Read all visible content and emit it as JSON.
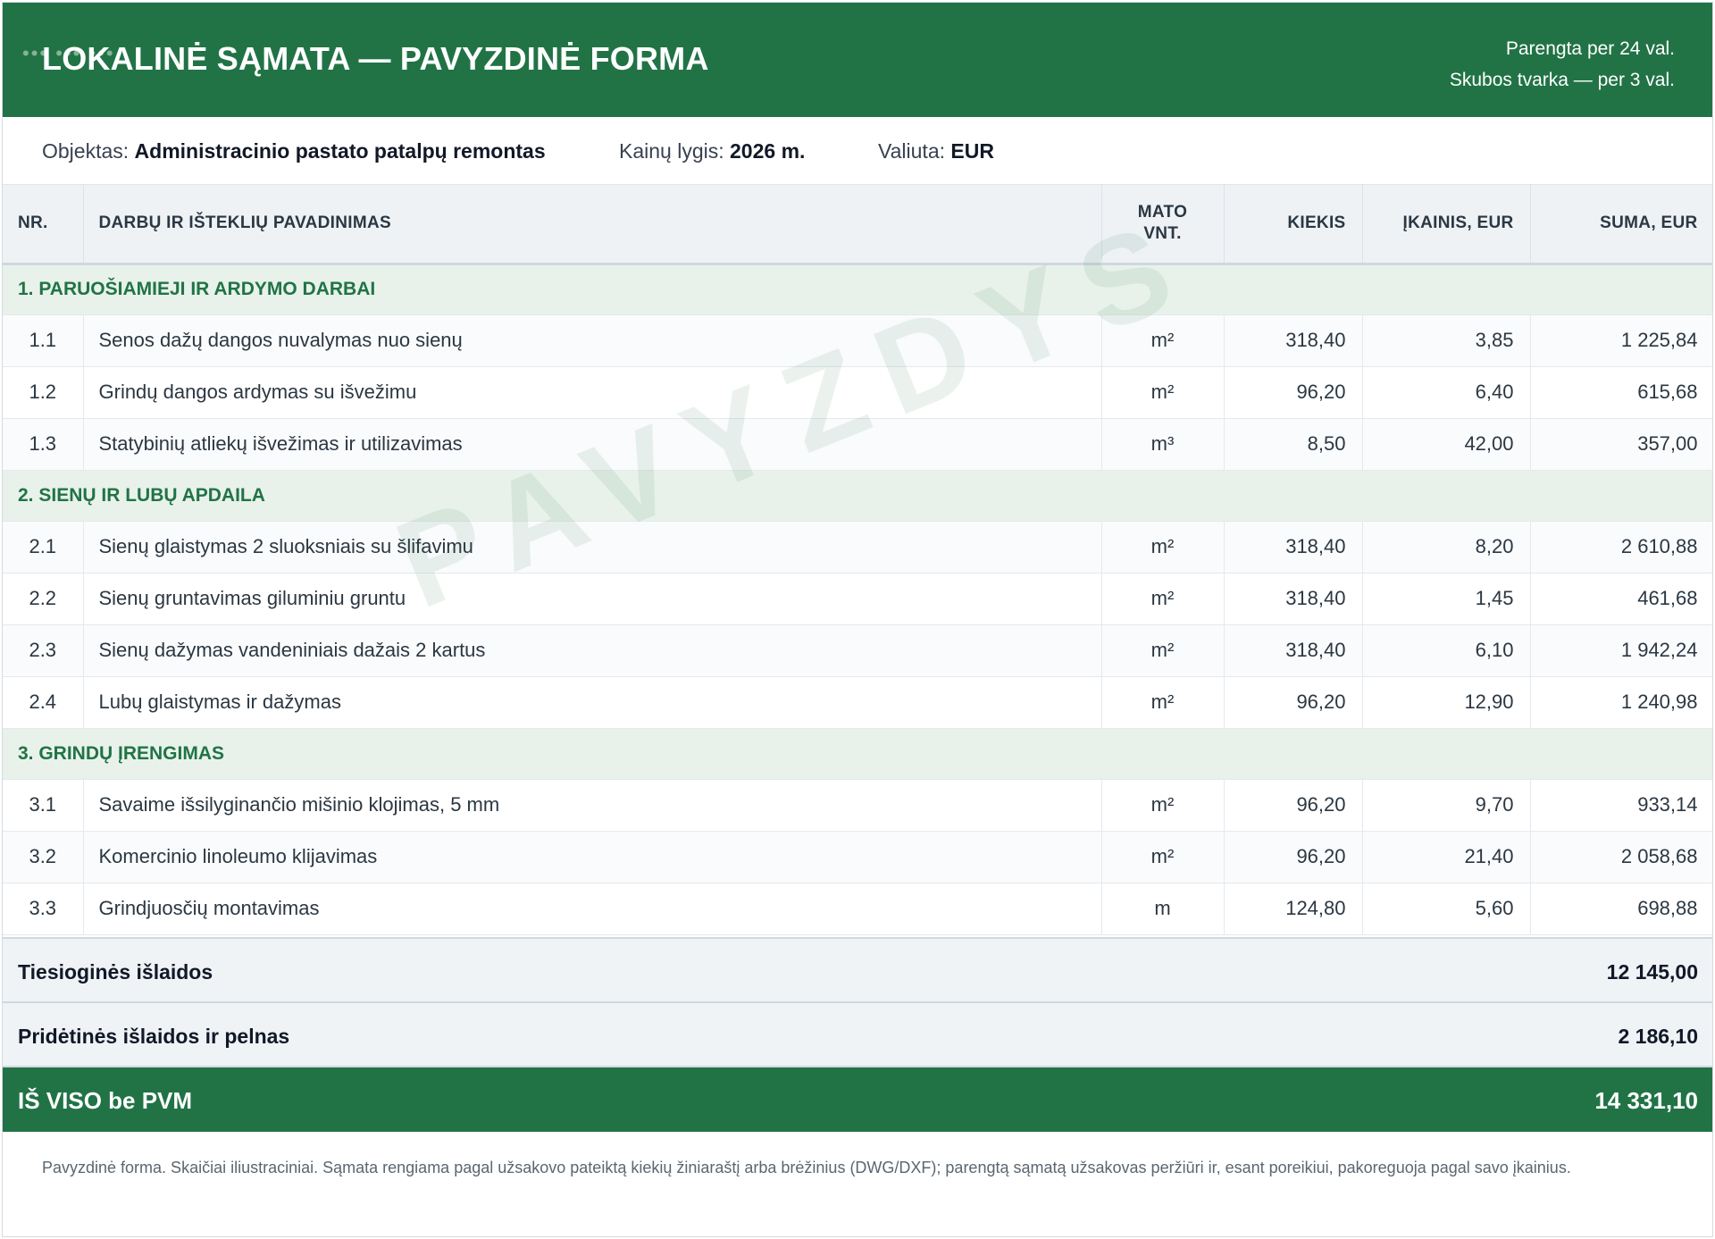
{
  "header": {
    "title": "LOKALINĖ SĄMATA — PAVYZDINĖ FORMA",
    "dots": "••• ••• •••",
    "meta_line1": "Parengta per 24 val.",
    "meta_line2": "Skubos tvarka — per 3 val."
  },
  "info": {
    "object_label": "Objektas:",
    "object_value": "Administracinio pastato patalpų remontas",
    "price_label": "Kainų lygis:",
    "price_value": "2026 m.",
    "currency_label": "Valiuta:",
    "currency_value": "EUR"
  },
  "table": {
    "headers": {
      "nr": "NR.",
      "name": "DARBŲ IR IŠTEKLIŲ PAVADINIMAS",
      "unit_line1": "MATO",
      "unit_line2": "VNT.",
      "qty": "KIEKIS",
      "price": "ĮKAINIS, EUR",
      "sum": "SUMA, EUR"
    },
    "sections": [
      {
        "title": "1. PARUOŠIAMIEJI IR ARDYMO DARBAI",
        "rows": [
          {
            "nr": "1.1",
            "name": "Senos dažų dangos nuvalymas nuo sienų",
            "unit": "m²",
            "qty": "318,40",
            "price": "3,85",
            "sum": "1 225,84"
          },
          {
            "nr": "1.2",
            "name": "Grindų dangos ardymas su išvežimu",
            "unit": "m²",
            "qty": "96,20",
            "price": "6,40",
            "sum": "615,68"
          },
          {
            "nr": "1.3",
            "name": "Statybinių atliekų išvežimas ir utilizavimas",
            "unit": "m³",
            "qty": "8,50",
            "price": "42,00",
            "sum": "357,00"
          }
        ]
      },
      {
        "title": "2. SIENŲ IR LUBŲ APDAILA",
        "rows": [
          {
            "nr": "2.1",
            "name": "Sienų glaistymas 2 sluoksniais su šlifavimu",
            "unit": "m²",
            "qty": "318,40",
            "price": "8,20",
            "sum": "2 610,88"
          },
          {
            "nr": "2.2",
            "name": "Sienų gruntavimas giluminiu gruntu",
            "unit": "m²",
            "qty": "318,40",
            "price": "1,45",
            "sum": "461,68"
          },
          {
            "nr": "2.3",
            "name": "Sienų dažymas vandeniniais dažais 2 kartus",
            "unit": "m²",
            "qty": "318,40",
            "price": "6,10",
            "sum": "1 942,24"
          },
          {
            "nr": "2.4",
            "name": "Lubų glaistymas ir dažymas",
            "unit": "m²",
            "qty": "96,20",
            "price": "12,90",
            "sum": "1 240,98"
          }
        ]
      },
      {
        "title": "3. GRINDŲ ĮRENGIMAS",
        "rows": [
          {
            "nr": "3.1",
            "name": "Savaime išsilyginančio mišinio klojimas, 5 mm",
            "unit": "m²",
            "qty": "96,20",
            "price": "9,70",
            "sum": "933,14"
          },
          {
            "nr": "3.2",
            "name": "Komercinio linoleumo klijavimas",
            "unit": "m²",
            "qty": "96,20",
            "price": "21,40",
            "sum": "2 058,68"
          },
          {
            "nr": "3.3",
            "name": "Grindjuosčių montavimas",
            "unit": "m",
            "qty": "124,80",
            "price": "5,60",
            "sum": "698,88"
          }
        ]
      }
    ]
  },
  "totals": {
    "direct_label": "Tiesioginės išlaidos",
    "direct_value": "12 145,00",
    "overhead_label": "Pridėtinės išlaidos ir pelnas",
    "overhead_value": "2 186,10",
    "grand_label": "IŠ VISO be PVM",
    "grand_value": "14 331,10"
  },
  "note": "Pavyzdinė forma. Skaičiai iliustraciniai. Sąmata rengiama pagal užsakovo pateiktą kiekių žiniaraštį arba brėžinius (DWG/DXF); parengtą sąmatą užsakovas peržiūri ir, esant poreikiui, pakoreguoja pagal savo įkainius.",
  "watermark": "PAVYZDYS",
  "colors": {
    "brand_green": "#217346",
    "section_bg": "#e8f2ea",
    "header_bg": "#eef2f5"
  }
}
